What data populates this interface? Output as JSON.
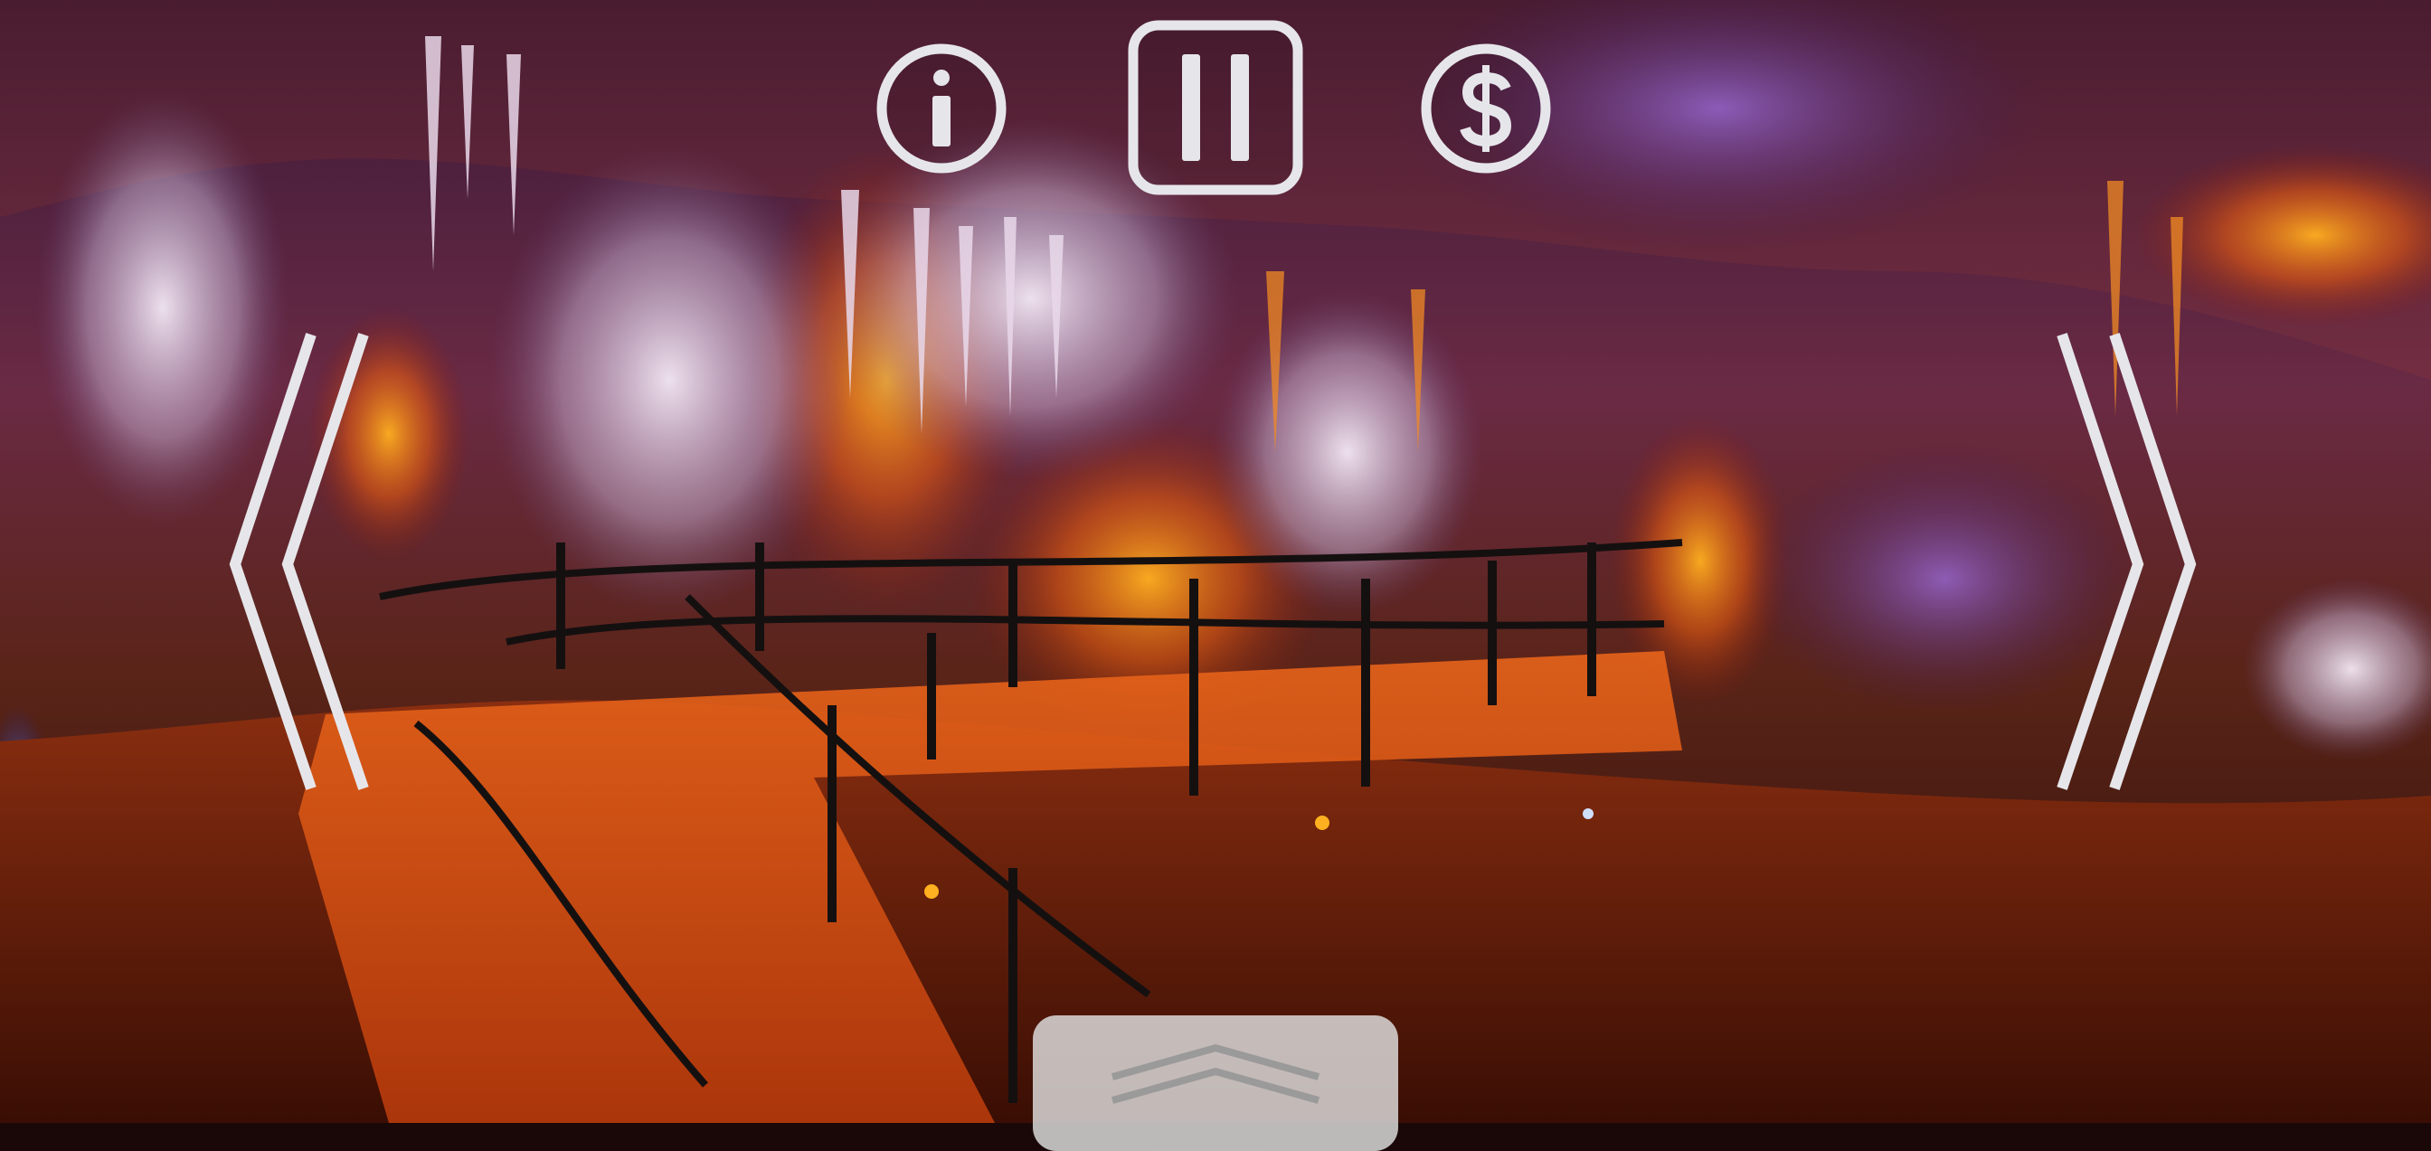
{
  "scene": {
    "subject": "cave-panorama-with-lit-stalactites-and-walkway"
  },
  "controls": {
    "info": {
      "icon": "info-icon"
    },
    "pause": {
      "icon": "pause-icon"
    },
    "buy": {
      "icon": "dollar-icon"
    },
    "previous": {
      "icon": "double-chevron-left-icon"
    },
    "next": {
      "icon": "chevron-right-icon"
    },
    "drawer": {
      "icon": "double-chevron-up-icon"
    }
  },
  "colors": {
    "control_stroke": "#e6e6ea",
    "drawer_bg": "#e1e1e1",
    "drawer_chevron": "#9a9a9a"
  }
}
